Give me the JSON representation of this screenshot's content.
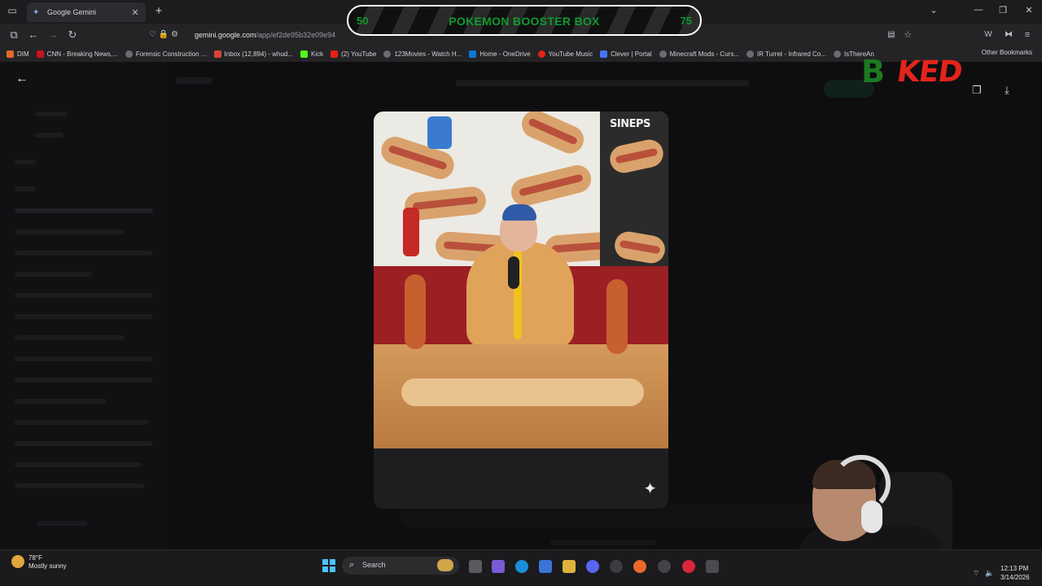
{
  "browser": {
    "tab_title": "Google Gemini",
    "url_domain": "gemini.google.com",
    "url_path": "/app/ef2de95b32e09e94",
    "bookmarks": [
      {
        "label": "DIM",
        "color": "#e0692b"
      },
      {
        "label": "CNN - Breaking News,...",
        "color": "#c4161c"
      },
      {
        "label": "Forensic Construction ...",
        "color": "#6b6b70"
      },
      {
        "label": "Inbox (12,894) - whud...",
        "color": "#d44638"
      },
      {
        "label": "Kick",
        "color": "#53fc18"
      },
      {
        "label": "(2) YouTube",
        "color": "#e62117"
      },
      {
        "label": "123Movies - Watch H...",
        "color": "#6b6b70"
      },
      {
        "label": "Home - OneDrive",
        "color": "#0f78d4"
      },
      {
        "label": "YouTube Music",
        "color": "#e62117"
      },
      {
        "label": "Clever | Portal",
        "color": "#4274f6"
      },
      {
        "label": "Minecraft Mods - Curs...",
        "color": "#6b6b70"
      },
      {
        "label": "IR Turret - Infrared Co...",
        "color": "#6b6b70"
      },
      {
        "label": "IsThereAn",
        "color": "#6b6b70"
      }
    ],
    "other_bookmarks": "Other Bookmarks"
  },
  "overlay": {
    "title": "POKEMON BOOSTER BOX",
    "left_value": "50",
    "right_value": "75",
    "accent": "#0f9b2e"
  },
  "logo": {
    "part1": "B",
    "part2": "KED"
  },
  "viewer": {
    "sign_text": "SINEPS"
  },
  "taskbar": {
    "weather_temp": "78°F",
    "weather_desc": "Mostly sunny",
    "search_label": "Search",
    "time": "12:13 PM",
    "date": "3/14/2026"
  }
}
